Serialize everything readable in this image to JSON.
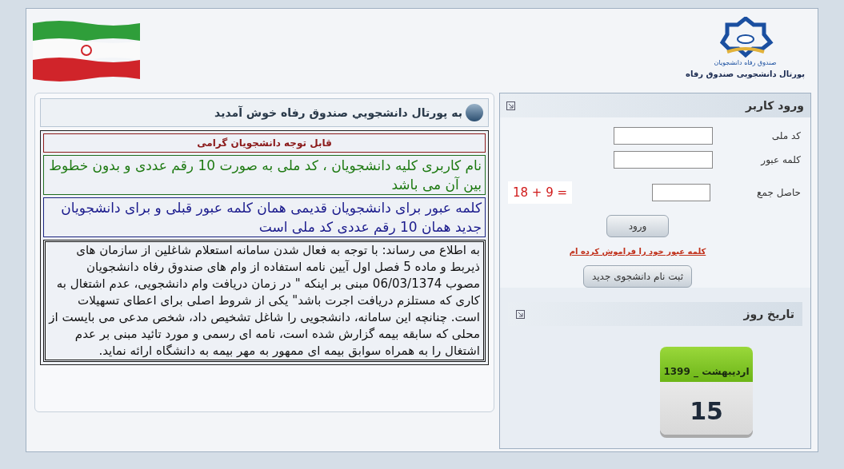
{
  "header": {
    "logo_caption": "صندوق رفاه دانشجویان",
    "logo_title": "پورتال دانشجویی صندوق رفاه"
  },
  "welcome": {
    "title": "به پورتال دانشجويي صندوق رفاه خوش آمديد",
    "notices": [
      {
        "kind": "heading",
        "text": "قابل توجه دانشجویان گرامی"
      },
      {
        "kind": "green",
        "text": "نام کاربری کلیه دانشجویان ، کد ملی به صورت 10 رقم عددی و بدون خطوط بین آن می باشد"
      },
      {
        "kind": "blue",
        "text": "کلمه عبور برای دانشجویان قدیمی همان کلمه عبور قبلی و برای دانشجویان جدید همان 10 رقم عددی کد ملی است"
      },
      {
        "kind": "body",
        "text": "به اطلاع می رساند: با توجه به فعال شدن سامانه استعلام شاغلین از سازمان های ذیربط و ماده 5 فصل اول آیین نامه استفاده از وام های صندوق رفاه دانشجویان مصوب 06/03/1374 مبنی بر اینکه \" در زمان دریافت وام دانشجویی، عدم اشتغال به کاری که مستلزم دریافت اجرت باشد\" یکی از شروط اصلی برای اعطای تسهیلات است. چنانچه این سامانه، دانشجویی را شاغل تشخیص داد، شخص مدعی می بایست از محلی که سابقه بیمه گزارش شده است، نامه ای رسمی و مورد تائید مبنی بر عدم اشتغال را به همراه سوابق بیمه ای ممهور به مهر بیمه به دانشگاه ارائه نماید."
      }
    ]
  },
  "login": {
    "title": "ورود کاربر",
    "fields": [
      {
        "label": "کد ملی"
      },
      {
        "label": "کلمه عبور"
      }
    ],
    "captcha": {
      "label": "حاصل جمع",
      "question": "18 + 9 ="
    },
    "submit": "ورود",
    "forgot_link": "کلمه عبور خود را فراموش کرده ام",
    "register": "ثبت نام دانشجوی جدید"
  },
  "date_panel": {
    "title": "تاریخ روز",
    "month": "اردیبهشت _ 1399",
    "day": "15"
  }
}
